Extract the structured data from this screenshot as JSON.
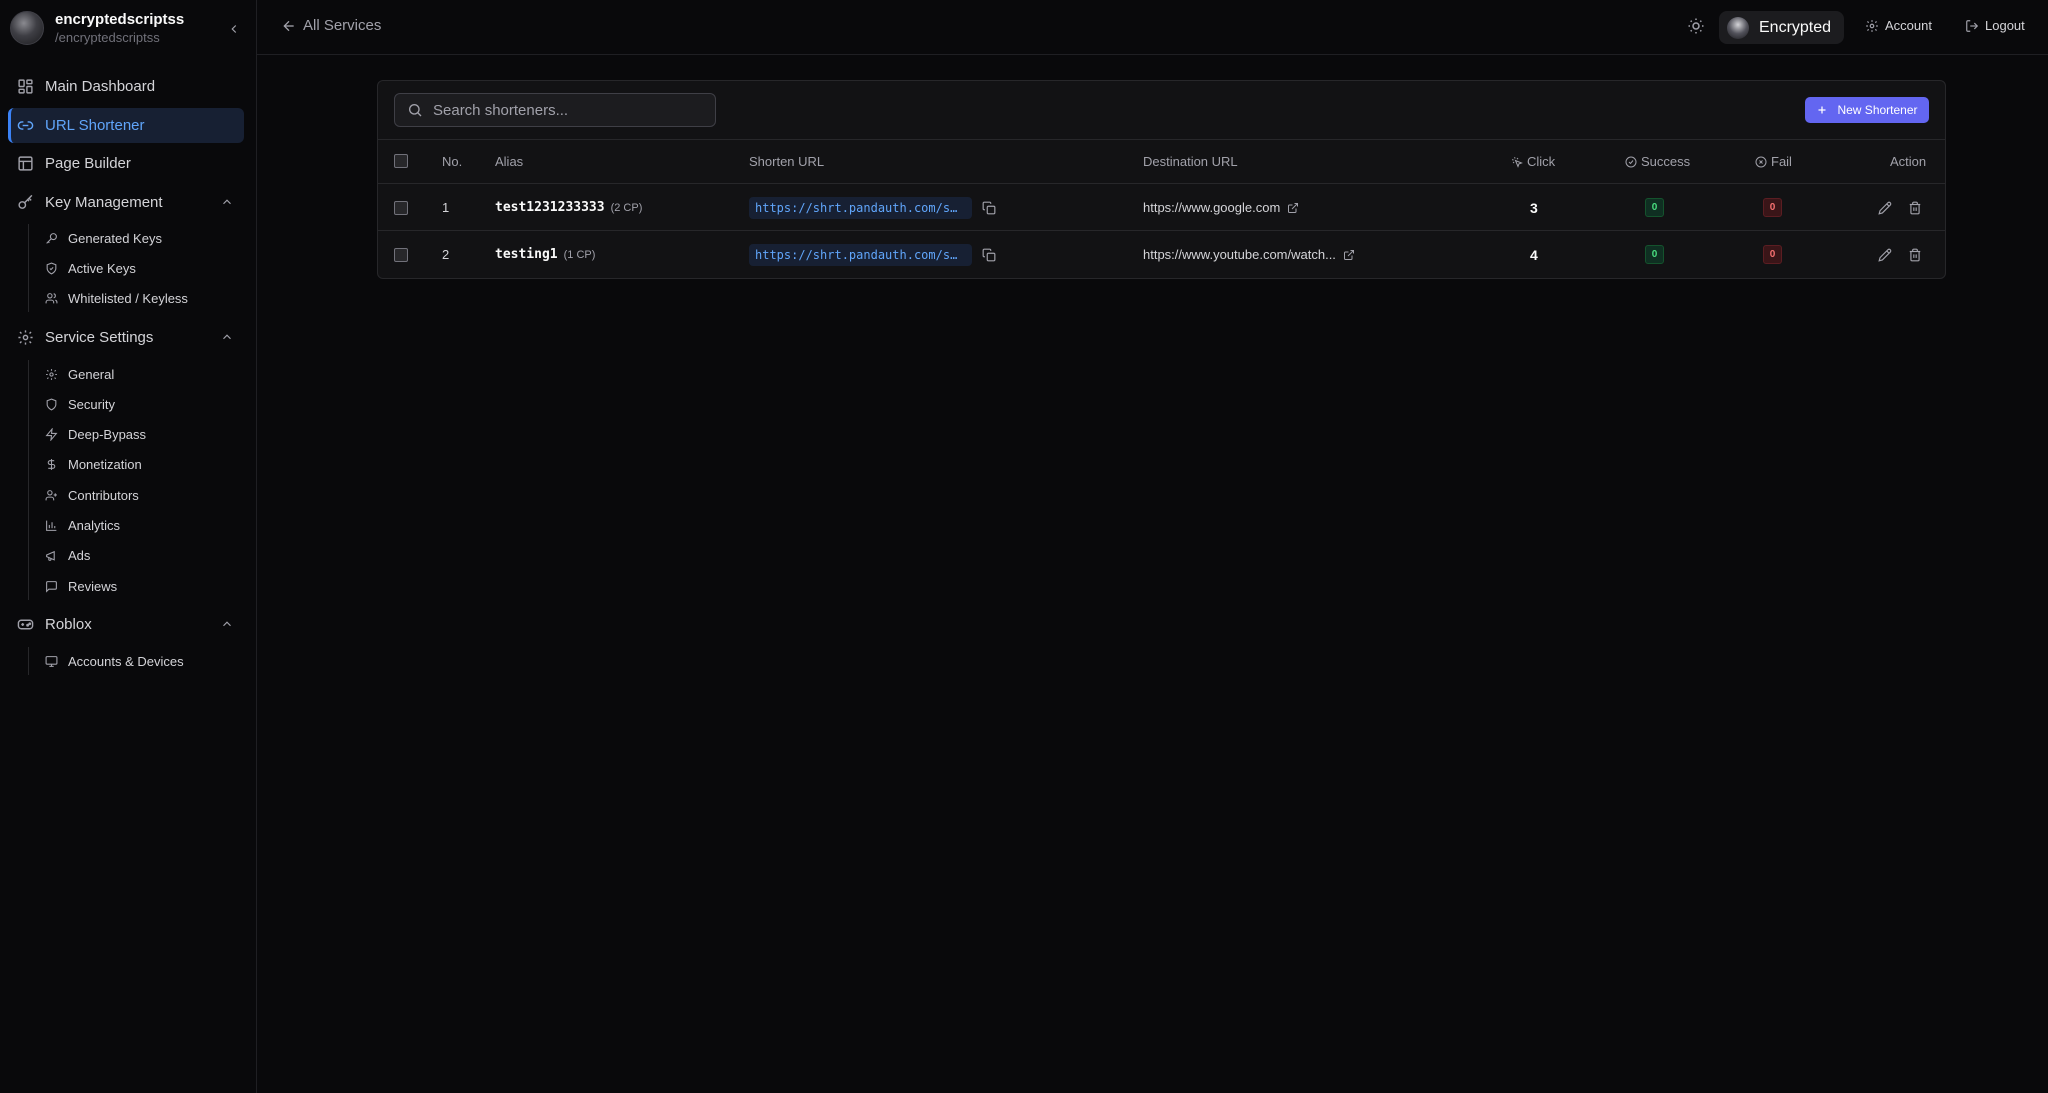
{
  "user": {
    "name": "encryptedscriptss",
    "handle": "/encryptedscriptss"
  },
  "nav": {
    "main_dashboard": "Main Dashboard",
    "url_shortener": "URL Shortener",
    "page_builder": "Page Builder",
    "key_management": {
      "label": "Key Management",
      "items": [
        "Generated Keys",
        "Active Keys",
        "Whitelisted / Keyless"
      ]
    },
    "service_settings": {
      "label": "Service Settings",
      "items": [
        "General",
        "Security",
        "Deep-Bypass",
        "Monetization",
        "Contributors",
        "Analytics",
        "Ads",
        "Reviews"
      ]
    },
    "roblox": {
      "label": "Roblox",
      "items": [
        "Accounts & Devices"
      ]
    }
  },
  "topbar": {
    "back_label": "All Services",
    "service_name": "Encrypted",
    "account_label": "Account",
    "logout_label": "Logout"
  },
  "search": {
    "placeholder": "Search shorteners...",
    "value": ""
  },
  "new_button_label": "New Shortener",
  "table": {
    "headers": {
      "no": "No.",
      "alias": "Alias",
      "shorten_url": "Shorten URL",
      "destination_url": "Destination URL",
      "click": "Click",
      "success": "Success",
      "fail": "Fail",
      "action": "Action"
    },
    "rows": [
      {
        "no": "1",
        "alias": "test1231233333",
        "cp": "(2 CP)",
        "shorten_url": "https://shrt.pandauth.com/s…",
        "destination_url": "https://www.google.com",
        "clicks": "3",
        "success": "0",
        "fail": "0"
      },
      {
        "no": "2",
        "alias": "testing1",
        "cp": "(1 CP)",
        "shorten_url": "https://shrt.pandauth.com/s…",
        "destination_url": "https://www.youtube.com/watch...",
        "clicks": "4",
        "success": "0",
        "fail": "0"
      }
    ]
  },
  "colors": {
    "accent": "#6366f1",
    "active_nav": "#60a5fa",
    "success": "#4ade80",
    "fail": "#f87171"
  }
}
